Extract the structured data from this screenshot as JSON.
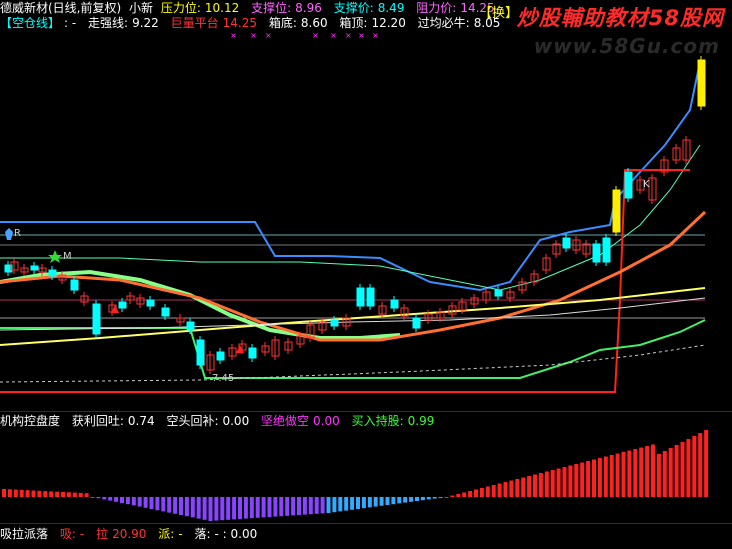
{
  "header": {
    "title": "德威新材(日线,前复权)",
    "sub": "小新",
    "items": [
      {
        "label": "压力位:",
        "value": "10.12",
        "color": "#ffff00"
      },
      {
        "label": "支撑位:",
        "value": "8.96",
        "color": "#ff66ff"
      },
      {
        "label": "支撑价:",
        "value": "8.49",
        "color": "#00ffff"
      },
      {
        "label": "阻力价:",
        "value": "14.25",
        "color": "#ff66ff"
      }
    ],
    "badge": "【换】"
  },
  "row2": {
    "tab": "【空仓线】",
    "tab_val": ": -",
    "items": [
      {
        "label": "走强线:",
        "value": "9.22",
        "color": "#ffffff"
      },
      {
        "label": "巨量平台",
        "value": "14.25",
        "color": "#ff3333"
      },
      {
        "label": "箱底:",
        "value": "8.60",
        "color": "#ffffff"
      },
      {
        "label": "箱顶:",
        "value": "12.20",
        "color": "#ffffff"
      },
      {
        "label": "过均必牛:",
        "value": "8.05",
        "color": "#ffffff"
      }
    ]
  },
  "watermark": "炒股輔助教材58股网",
  "url": "www.58Gu.com",
  "chart_labels": {
    "low_price": "7.45",
    "marker_r": "R",
    "marker_m": "M",
    "marker_k": "K"
  },
  "panel2": {
    "items": [
      {
        "label": "机构控盘度",
        "value": "",
        "color": "#ffffff"
      },
      {
        "label": "获利回吐:",
        "value": "0.74",
        "color": "#ffffff"
      },
      {
        "label": "空头回补:",
        "value": "0.00",
        "color": "#ffffff"
      },
      {
        "label": "坚绝做空",
        "value": "0.00",
        "color": "#ff33ff"
      },
      {
        "label": "买入持股:",
        "value": "0.99",
        "color": "#33ff33"
      }
    ]
  },
  "panel3": {
    "items": [
      {
        "label": "吸拉派落",
        "value": "",
        "color": "#ffffff"
      },
      {
        "label": "吸:",
        "value": "-",
        "color": "#ff3333"
      },
      {
        "label": "拉",
        "value": "20.90",
        "color": "#ff3333"
      },
      {
        "label": "派:",
        "value": "-",
        "color": "#ffff00"
      },
      {
        "label": "落:",
        "value": "- : 0.00",
        "color": "#ffffff"
      }
    ]
  },
  "colors": {
    "up": "#ff3333",
    "down": "#00ffff",
    "background": "#000000"
  }
}
